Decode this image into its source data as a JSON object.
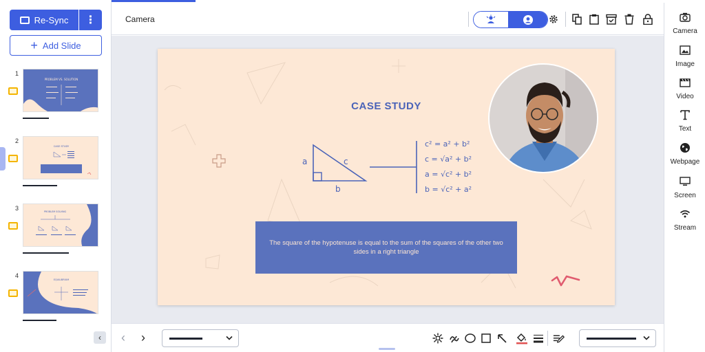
{
  "sidebar": {
    "resync_label": "Re-Sync",
    "add_slide_label": "Add Slide",
    "collapse_glyph": "‹",
    "slides": [
      {
        "number": "1",
        "thumb_title": "PROBLEM VS. SOLUTION"
      },
      {
        "number": "2",
        "thumb_title": "CASE STUDY"
      },
      {
        "number": "3",
        "thumb_title": "PROBLEM SOLVING"
      },
      {
        "number": "4",
        "thumb_title": "EQUILIBRIUM"
      }
    ]
  },
  "header": {
    "title": "Camera"
  },
  "slide": {
    "title": "CASE STUDY",
    "caption": "The square of the hypotenuse is equal to the sum of the squares of the other two sides in a right triangle",
    "triangle_labels": {
      "a": "a",
      "b": "b",
      "c": "c"
    },
    "formulas": [
      "c² = a² + b²",
      "c = √a² + b²",
      "a = √c² + b²",
      "b = √c² + a²"
    ]
  },
  "right_panel": {
    "items": [
      {
        "label": "Camera",
        "icon": "camera-icon"
      },
      {
        "label": "Image",
        "icon": "image-icon"
      },
      {
        "label": "Video",
        "icon": "video-icon"
      },
      {
        "label": "Text",
        "icon": "text-icon"
      },
      {
        "label": "Webpage",
        "icon": "globe-icon"
      },
      {
        "label": "Screen",
        "icon": "monitor-icon"
      },
      {
        "label": "Stream",
        "icon": "wifi-icon"
      }
    ]
  },
  "bottom_bar": {
    "prev_glyph": "‹",
    "next_glyph": "›"
  },
  "colors": {
    "accent": "#3d5ee0",
    "slide_background": "#fde8d6",
    "slide_blue": "#5a72bd",
    "badge_yellow": "#f4b400"
  }
}
